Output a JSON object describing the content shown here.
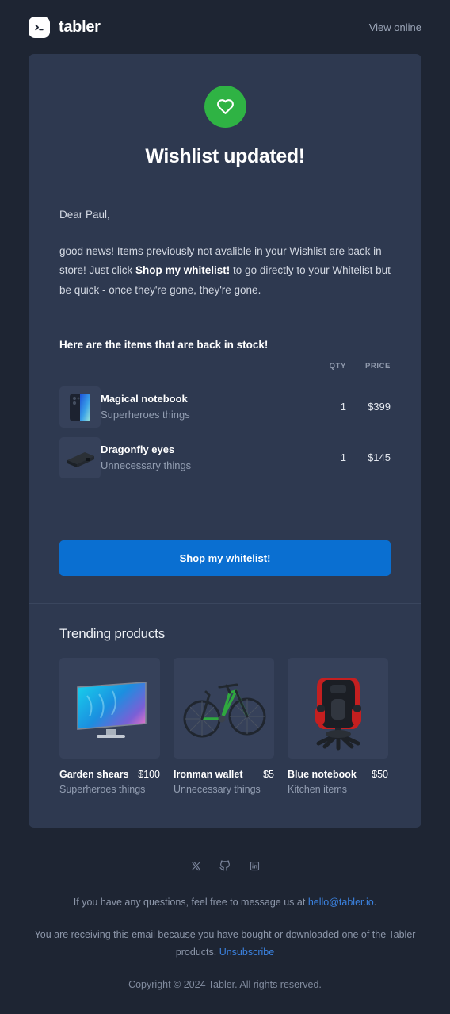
{
  "header": {
    "brand_name": "tabler",
    "brand_icon": "terminal-prompt-icon",
    "view_online": "View online"
  },
  "hero": {
    "icon": "heart-icon",
    "icon_bg": "#2fb344",
    "title": "Wishlist updated!"
  },
  "body": {
    "greeting": "Dear Paul,",
    "intro_before": "good news! Items previously not avalible in your Wishlist are back in store! Just click ",
    "intro_bold": "Shop my whitelist!",
    "intro_after": " to go directly to your Whitelist but be quick - once they're gone, they're gone.",
    "items_heading": "Here are the items that are back in stock!"
  },
  "items_table": {
    "columns": [
      "",
      "",
      "QTY",
      "PRICE"
    ],
    "rows": [
      {
        "thumb": "smartphone-image",
        "name": "Magical notebook",
        "category": "Superheroes things",
        "qty": "1",
        "price": "$399"
      },
      {
        "thumb": "power-bank-image",
        "name": "Dragonfly eyes",
        "category": "Unnecessary things",
        "qty": "1",
        "price": "$145"
      }
    ]
  },
  "cta": {
    "label": "Shop my whitelist!",
    "color": "#0a6fd1"
  },
  "trending": {
    "title": "Trending products",
    "products": [
      {
        "image": "television-image",
        "name": "Garden shears",
        "category": "Superheroes things",
        "price": "$100"
      },
      {
        "image": "bicycle-image",
        "name": "Ironman wallet",
        "category": "Unnecessary things",
        "price": "$5"
      },
      {
        "image": "gaming-chair-image",
        "name": "Blue notebook",
        "category": "Kitchen items",
        "price": "$50"
      }
    ]
  },
  "footer": {
    "socials": [
      "x-icon",
      "github-icon",
      "linkedin-icon"
    ],
    "contact_before": "If you have any questions, feel free to message us at ",
    "contact_email": "hello@tabler.io",
    "contact_after": ".",
    "legal_before": "You are receiving this email because you have bought or downloaded one of the Tabler products. ",
    "unsubscribe": "Unsubscribe",
    "copyright": "Copyright © 2024 Tabler. All rights reserved.",
    "link_color": "#3b82e0"
  }
}
